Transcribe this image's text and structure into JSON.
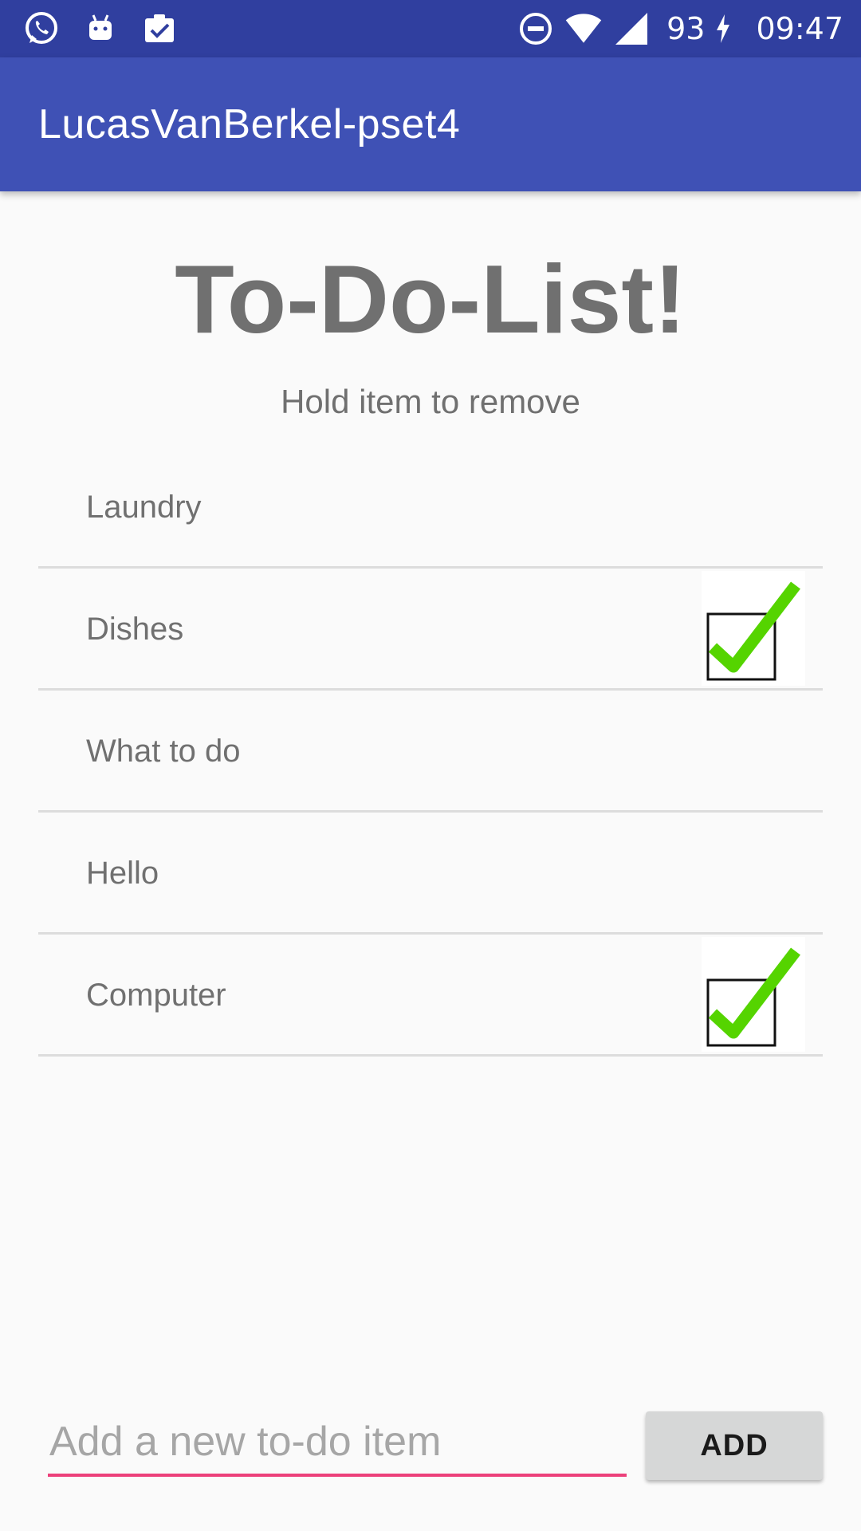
{
  "status_bar": {
    "battery_level": "93",
    "time": "09:47",
    "left_icons": [
      "whatsapp-icon",
      "android-notification-icon",
      "clipboard-check-icon"
    ],
    "right_icons": [
      "do-not-disturb-icon",
      "wifi-icon",
      "cellular-signal-icon",
      "charging-bolt-icon"
    ]
  },
  "app_bar": {
    "title": "LucasVanBerkel-pset4",
    "color": "#3f51b5"
  },
  "main": {
    "heading": "To-Do-List!",
    "subtitle": "Hold item to remove",
    "items": [
      {
        "label": "Laundry",
        "checked": false
      },
      {
        "label": "Dishes",
        "checked": true
      },
      {
        "label": "What to do",
        "checked": false
      },
      {
        "label": "Hello",
        "checked": false
      },
      {
        "label": "Computer",
        "checked": true
      }
    ]
  },
  "footer": {
    "input_placeholder": "Add a new to-do item",
    "input_value": "",
    "add_button_label": "ADD",
    "accent_color": "#ec407a"
  }
}
